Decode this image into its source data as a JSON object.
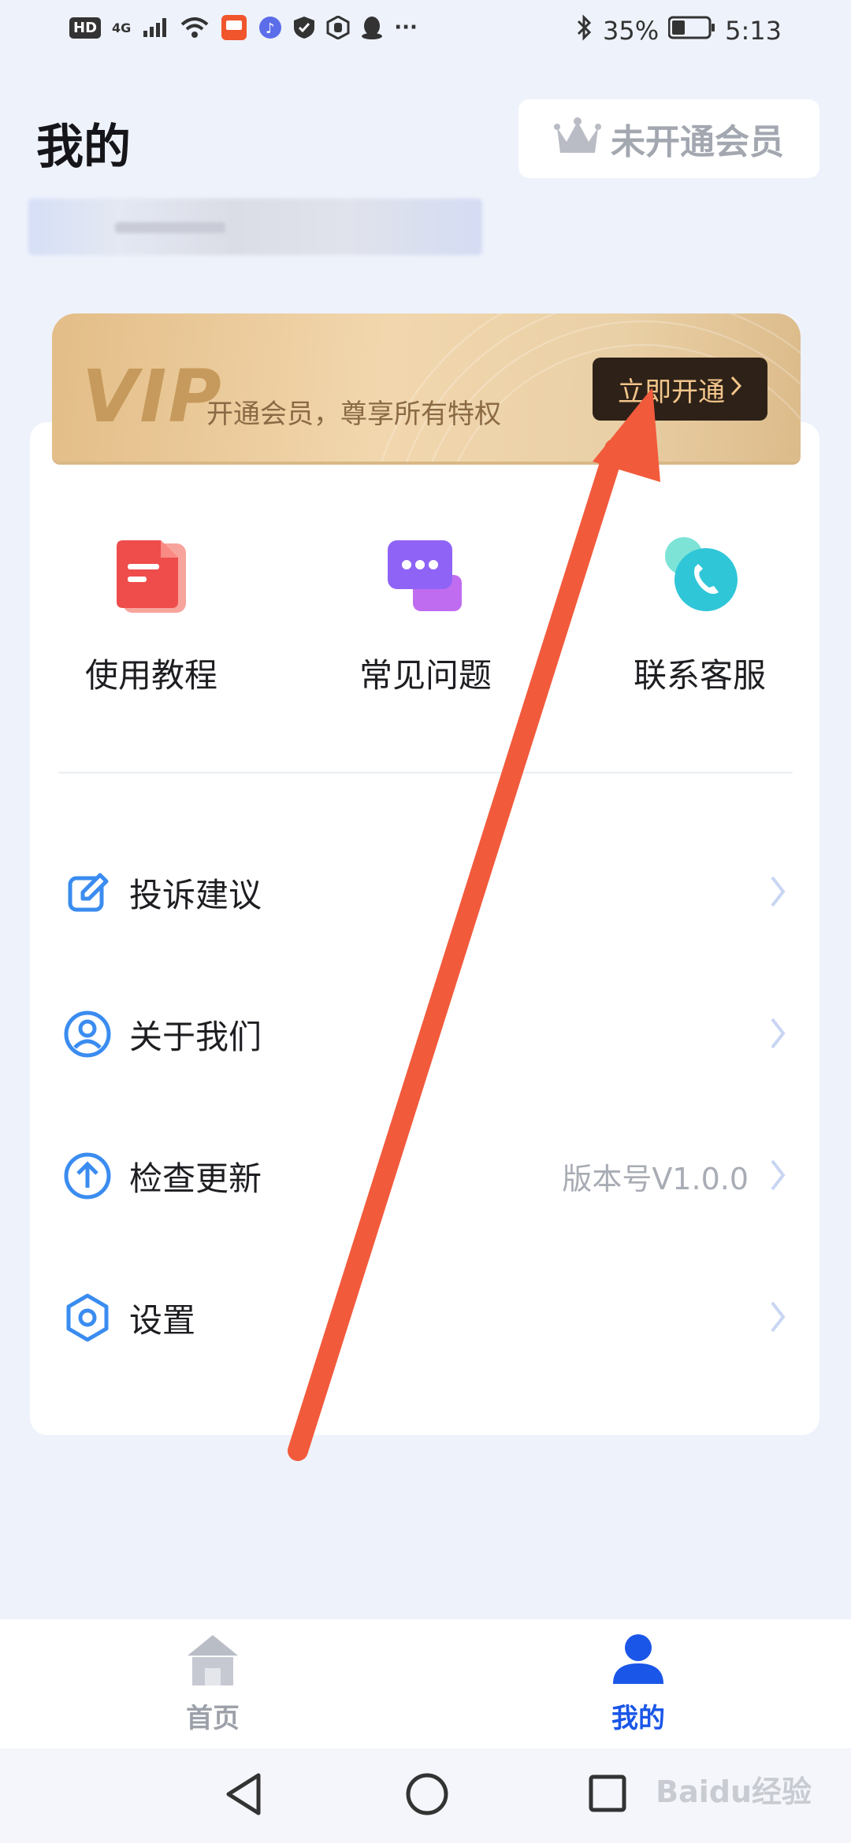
{
  "status_bar": {
    "network": "4G",
    "battery": "35%",
    "time": "5:13"
  },
  "header": {
    "title": "我的",
    "member_label": "未开通会员"
  },
  "vip_banner": {
    "badge": "VIP",
    "description": "开通会员，尊享所有特权",
    "button_label": "立即开通"
  },
  "quick_actions": [
    {
      "label": "使用教程",
      "icon": "document-icon"
    },
    {
      "label": "常见问题",
      "icon": "chat-icon"
    },
    {
      "label": "联系客服",
      "icon": "phone-icon"
    }
  ],
  "menu": [
    {
      "label": "投诉建议",
      "value": "",
      "icon": "edit-icon"
    },
    {
      "label": "关于我们",
      "value": "",
      "icon": "user-circle-icon"
    },
    {
      "label": "检查更新",
      "value": "版本号V1.0.0",
      "icon": "upload-icon"
    },
    {
      "label": "设置",
      "value": "",
      "icon": "gear-icon"
    }
  ],
  "bottom_nav": [
    {
      "label": "首页",
      "active": false
    },
    {
      "label": "我的",
      "active": true
    }
  ],
  "watermark": "Baidu经验",
  "colors": {
    "accent": "#1a56e8",
    "arrow": "#f25a3c",
    "vip_gold": "#e8c896"
  }
}
